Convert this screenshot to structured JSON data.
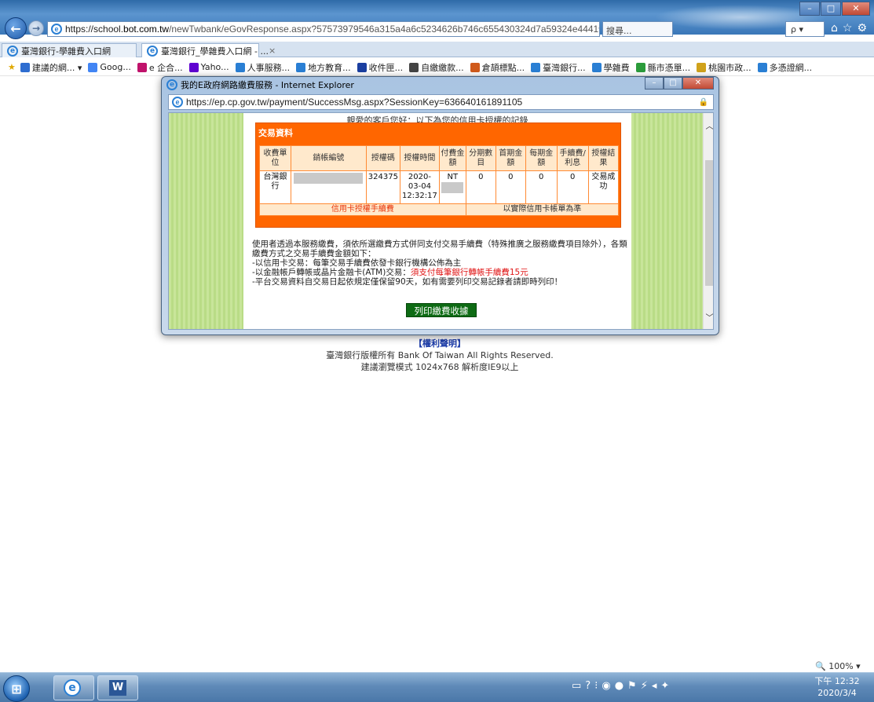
{
  "browser": {
    "url_host_prefix": "https://school.",
    "url_host_bold": "bot.com.tw",
    "url_path": "/newTwbank/eGovResponse.aspx?57573979546a315a4a6c5234626b746c655430324d7a59324e4441",
    "url_controls": "▾ 🔒 ↻",
    "search_placeholder": "搜尋...",
    "search2_text": "ρ ▾"
  },
  "tabs": [
    {
      "label": "臺灣銀行-學雜費入口網"
    },
    {
      "label": "臺灣銀行_學雜費入口網 - ...",
      "close": "×"
    }
  ],
  "favorites": [
    {
      "label": "建議的網... ▾",
      "color": "#2e6dd0"
    },
    {
      "label": "Goog...",
      "color": "#4285f4"
    },
    {
      "label": "e 企合...",
      "color": "#c0126b"
    },
    {
      "label": "Yaho...",
      "color": "#5f01d1"
    },
    {
      "label": "人事服務...",
      "color": "#2a7fd4"
    },
    {
      "label": "地方教育...",
      "color": "#2a7fd4"
    },
    {
      "label": "收件匣...",
      "color": "#1b3fa0"
    },
    {
      "label": "自繳繳款...",
      "color": "#444444"
    },
    {
      "label": "倉頡標點...",
      "color": "#d05a1b"
    },
    {
      "label": "臺灣銀行...",
      "color": "#2a7fd4"
    },
    {
      "label": "學雜費",
      "color": "#2a7fd4"
    },
    {
      "label": "縣市憑單...",
      "color": "#2b9c3b"
    },
    {
      "label": "桃園市政...",
      "color": "#d0a21b"
    },
    {
      "label": "多憑證網...",
      "color": "#2a7fd4"
    }
  ],
  "background_page": {
    "link_text": "【權利聲明】",
    "copyright": "臺灣銀行版權所有 Bank Of Taiwan All Rights Reserved.",
    "recommend": "建議瀏覽模式 1024x768 解析度IE9以上"
  },
  "popup": {
    "title": "我的E政府網路繳費服務 - Internet Explorer",
    "url": "https://ep.cp.gov.tw/payment/SuccessMsg.aspx?SessionKey=636640161891105",
    "greeting": "親愛的客戶您好：以下為您的信用卡授權的記錄",
    "section_title": "交易資料",
    "table": {
      "headers": [
        "收費單位",
        "銷帳編號",
        "授權碼",
        "授權時間",
        "付費金額",
        "分期數目",
        "首期金額",
        "每期金額",
        "手續費/利息",
        "授權結果"
      ],
      "row": {
        "unit": "台灣銀行",
        "auth_code": "324375",
        "auth_time": "2020-03-04 12:32:17",
        "amount": "NT",
        "installments": "0",
        "first": "0",
        "each": "0",
        "fee": "0",
        "result": "交易成功"
      },
      "footer_left": "信用卡授權手續費",
      "footer_right": "以實際信用卡帳單為準"
    },
    "notes": {
      "line1": "使用者透過本服務繳費，須依所選繳費方式併同支付交易手續費（特殊推廣之服務繳費項目除外），各類繳費方式之交易手續費金額如下：",
      "line2": "-以信用卡交易：每筆交易手續費依發卡銀行機構公佈為主",
      "line3_prefix": "-以金融帳戶轉帳或晶片金融卡(ATM)交易：",
      "line3_red": "須支付每筆銀行轉帳手續費15元",
      "line4": "-平台交易資料自交易日起依規定僅保留90天，如有需要列印交易記錄者請即時列印！"
    },
    "print_button": "列印繳費收據"
  },
  "statusbar": {
    "zoom": "100%  ▾"
  },
  "taskbar": {
    "time": "下午 12:32",
    "date": "2020/3/4"
  },
  "colors": {
    "orange": "#ff6600",
    "green_button": "#0e6b14",
    "side_green": "#c8e59a",
    "ie_blue": "#2a7fd4"
  }
}
